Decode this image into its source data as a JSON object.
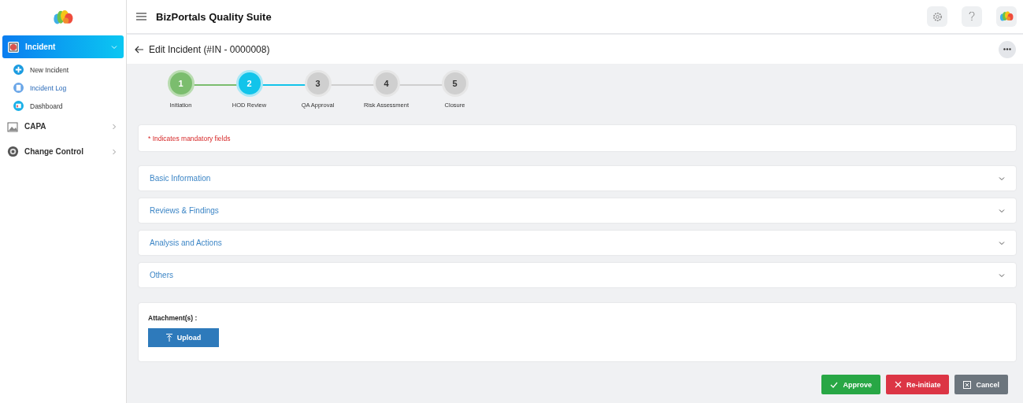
{
  "sidebar": {
    "items": [
      {
        "label": "Incident",
        "expanded": true,
        "selected": true,
        "children": [
          {
            "label": "New Incident",
            "selected": false
          },
          {
            "label": "Incident Log",
            "selected": true
          },
          {
            "label": "Dashboard",
            "selected": false
          }
        ]
      },
      {
        "label": "CAPA",
        "expanded": false,
        "selected": false
      },
      {
        "label": "Change Control",
        "expanded": false,
        "selected": false
      }
    ]
  },
  "topbar": {
    "title": "BizPortals Quality Suite"
  },
  "page": {
    "title": "Edit Incident (#IN - 0000008)"
  },
  "steps": [
    {
      "number": "1",
      "label": "Initiation",
      "completed": true,
      "selected": false
    },
    {
      "number": "2",
      "label": "HOD Review",
      "completed": false,
      "selected": true
    },
    {
      "number": "3",
      "label": "QA Approval",
      "completed": false,
      "selected": false
    },
    {
      "number": "4",
      "label": "Risk Assessment",
      "completed": false,
      "selected": false
    },
    {
      "number": "5",
      "label": "Closure",
      "completed": false,
      "selected": false
    }
  ],
  "notice": "* Indicates mandatory fields",
  "sections": [
    {
      "title": "Basic Information"
    },
    {
      "title": "Reviews & Findings"
    },
    {
      "title": "Analysis and Actions"
    },
    {
      "title": "Others"
    }
  ],
  "attachments": {
    "label": "Attachment(s) :",
    "button": "Upload"
  },
  "actions": [
    {
      "label": "Approve",
      "kind": "approve"
    },
    {
      "label": "Re-initiate",
      "kind": "reinitiate"
    },
    {
      "label": "Cancel",
      "kind": "cancel"
    }
  ]
}
